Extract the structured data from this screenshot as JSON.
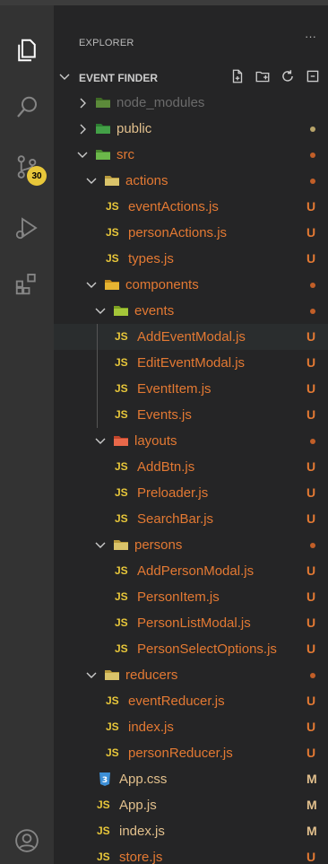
{
  "explorer": {
    "title": "EXPLORER",
    "more": "···",
    "section": "EVENT FINDER"
  },
  "activity": {
    "badge": "30",
    "icons": [
      "files-icon",
      "search-icon",
      "source-control-icon",
      "run-debug-icon",
      "extensions-icon",
      "account-icon"
    ]
  },
  "colors": {
    "untracked": "#e37933",
    "modified": "#e2c08d",
    "dim": "#7a7a7a",
    "js": "#e8c73a",
    "folder_src": "#6bb84a",
    "css": "#3d8fd6"
  },
  "tree": [
    {
      "name": "node_modules",
      "kind": "folder-node",
      "depth": 0,
      "open": false,
      "status": "",
      "dot": false,
      "color": "#6b6b6b"
    },
    {
      "name": "public",
      "kind": "folder-public",
      "depth": 0,
      "open": false,
      "status": "",
      "dot": true,
      "color": "#e2c08d"
    },
    {
      "name": "src",
      "kind": "folder-src",
      "depth": 0,
      "open": true,
      "status": "",
      "dot": true,
      "color": "#e37933"
    },
    {
      "name": "actions",
      "kind": "folder",
      "depth": 1,
      "open": true,
      "status": "",
      "dot": true,
      "color": "#e37933"
    },
    {
      "name": "eventActions.js",
      "kind": "js",
      "depth": 2,
      "status": "U",
      "color": "#e37933"
    },
    {
      "name": "personActions.js",
      "kind": "js",
      "depth": 2,
      "status": "U",
      "color": "#e37933"
    },
    {
      "name": "types.js",
      "kind": "js",
      "depth": 2,
      "status": "U",
      "color": "#e37933"
    },
    {
      "name": "components",
      "kind": "folder-comp",
      "depth": 1,
      "open": true,
      "status": "",
      "dot": true,
      "color": "#e37933"
    },
    {
      "name": "events",
      "kind": "folder-events",
      "depth": 2,
      "open": true,
      "status": "",
      "dot": true,
      "color": "#e37933"
    },
    {
      "name": "AddEventModal.js",
      "kind": "js",
      "depth": 3,
      "status": "U",
      "color": "#e37933",
      "selected": true
    },
    {
      "name": "EditEventModal.js",
      "kind": "js",
      "depth": 3,
      "status": "U",
      "color": "#e37933"
    },
    {
      "name": "EventItem.js",
      "kind": "js",
      "depth": 3,
      "status": "U",
      "color": "#e37933"
    },
    {
      "name": "Events.js",
      "kind": "js",
      "depth": 3,
      "status": "U",
      "color": "#e37933"
    },
    {
      "name": "layouts",
      "kind": "folder-layouts",
      "depth": 2,
      "open": true,
      "status": "",
      "dot": true,
      "color": "#e37933"
    },
    {
      "name": "AddBtn.js",
      "kind": "js",
      "depth": 3,
      "status": "U",
      "color": "#e37933"
    },
    {
      "name": "Preloader.js",
      "kind": "js",
      "depth": 3,
      "status": "U",
      "color": "#e37933"
    },
    {
      "name": "SearchBar.js",
      "kind": "js",
      "depth": 3,
      "status": "U",
      "color": "#e37933"
    },
    {
      "name": "persons",
      "kind": "folder",
      "depth": 2,
      "open": true,
      "status": "",
      "dot": true,
      "color": "#e37933"
    },
    {
      "name": "AddPersonModal.js",
      "kind": "js",
      "depth": 3,
      "status": "U",
      "color": "#e37933"
    },
    {
      "name": "PersonItem.js",
      "kind": "js",
      "depth": 3,
      "status": "U",
      "color": "#e37933"
    },
    {
      "name": "PersonListModal.js",
      "kind": "js",
      "depth": 3,
      "status": "U",
      "color": "#e37933"
    },
    {
      "name": "PersonSelectOptions.js",
      "kind": "js",
      "depth": 3,
      "status": "U",
      "color": "#e37933"
    },
    {
      "name": "reducers",
      "kind": "folder",
      "depth": 1,
      "open": true,
      "status": "",
      "dot": true,
      "color": "#e37933"
    },
    {
      "name": "eventReducer.js",
      "kind": "js",
      "depth": 2,
      "status": "U",
      "color": "#e37933"
    },
    {
      "name": "index.js",
      "kind": "js",
      "depth": 2,
      "status": "U",
      "color": "#e37933"
    },
    {
      "name": "personReducer.js",
      "kind": "js",
      "depth": 2,
      "status": "U",
      "color": "#e37933"
    },
    {
      "name": "App.css",
      "kind": "css",
      "depth": 1,
      "status": "M",
      "color": "#e2c08d"
    },
    {
      "name": "App.js",
      "kind": "js",
      "depth": 1,
      "status": "M",
      "color": "#e2c08d"
    },
    {
      "name": "index.js",
      "kind": "js",
      "depth": 1,
      "status": "M",
      "color": "#e2c08d"
    },
    {
      "name": "store.js",
      "kind": "js",
      "depth": 1,
      "status": "U",
      "color": "#e37933"
    }
  ]
}
